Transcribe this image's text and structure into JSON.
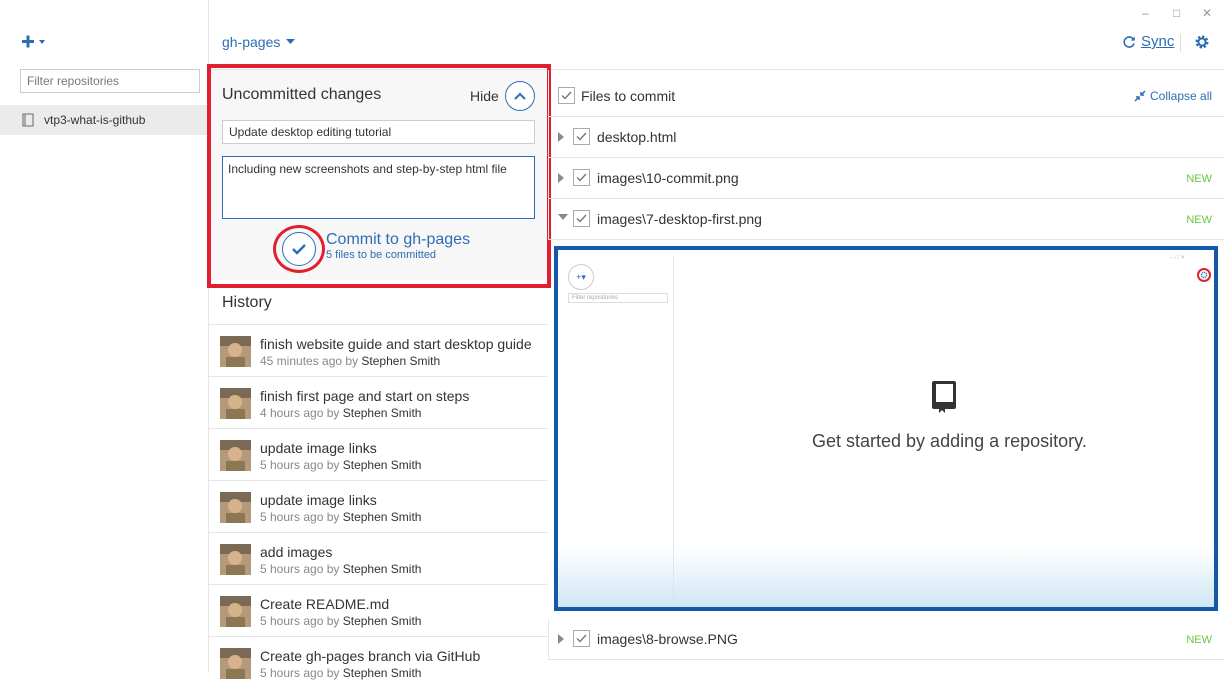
{
  "sidebar": {
    "filter_placeholder": "Filter repositories",
    "repo_name": "vtp3-what-is-github"
  },
  "toolbar": {
    "branch": "gh-pages",
    "sync_label": "Sync"
  },
  "uncommitted": {
    "title": "Uncommitted changes",
    "hide_label": "Hide",
    "summary_value": "Update desktop editing tutorial",
    "description_value": "Including new screenshots and step-by-step html file",
    "commit_label": "Commit to gh-pages",
    "commit_sub": "5 files to be committed"
  },
  "history": {
    "title": "History",
    "commits": [
      {
        "message": "finish website guide and start desktop guide",
        "time": "45 minutes ago by",
        "author": "Stephen Smith"
      },
      {
        "message": "finish first page and start on steps",
        "time": "4 hours ago by",
        "author": "Stephen Smith"
      },
      {
        "message": "update image links",
        "time": "5 hours ago by",
        "author": "Stephen Smith"
      },
      {
        "message": "update image links",
        "time": "5 hours ago by",
        "author": "Stephen Smith"
      },
      {
        "message": "add images",
        "time": "5 hours ago by",
        "author": "Stephen Smith"
      },
      {
        "message": "Create README.md",
        "time": "5 hours ago by",
        "author": "Stephen Smith"
      },
      {
        "message": "Create gh-pages branch via GitHub",
        "time": "5 hours ago by",
        "author": "Stephen Smith"
      }
    ]
  },
  "files": {
    "header_label": "Files to commit",
    "collapse_label": "Collapse all",
    "rows": [
      {
        "name": "desktop.html",
        "badge": ""
      },
      {
        "name": "images\\10-commit.png",
        "badge": "NEW"
      },
      {
        "name": "images\\7-desktop-first.png",
        "badge": "NEW"
      },
      {
        "name": "images\\8-browse.PNG",
        "badge": "NEW"
      }
    ]
  },
  "preview": {
    "filter_placeholder": "Filter repositories",
    "add_label": "+▾",
    "message": "Get started by adding a repository."
  },
  "colors": {
    "accent": "#2d6db4",
    "highlight_red": "#e1202f",
    "new_badge": "#6cc644"
  }
}
